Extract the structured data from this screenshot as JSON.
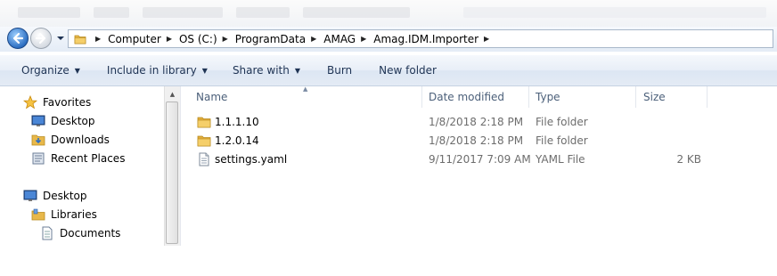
{
  "address": {
    "crumbs": [
      "Computer",
      "OS (C:)",
      "ProgramData",
      "AMAG",
      "Amag.IDM.Importer"
    ]
  },
  "toolbar": {
    "organize": "Organize",
    "include_in_library": "Include in library",
    "share_with": "Share with",
    "burn": "Burn",
    "new_folder": "New folder"
  },
  "sidebar": {
    "favorites": "Favorites",
    "desktop_fav": "Desktop",
    "downloads": "Downloads",
    "recent_places": "Recent Places",
    "desktop": "Desktop",
    "libraries": "Libraries",
    "documents": "Documents"
  },
  "columns": {
    "name": "Name",
    "date_modified": "Date modified",
    "type": "Type",
    "size": "Size"
  },
  "files": [
    {
      "name": "1.1.1.10",
      "date": "1/8/2018 2:18 PM",
      "type": "File folder",
      "size": "",
      "icon": "folder-icon"
    },
    {
      "name": "1.2.0.14",
      "date": "1/8/2018 2:18 PM",
      "type": "File folder",
      "size": "",
      "icon": "folder-icon"
    },
    {
      "name": "settings.yaml",
      "date": "9/11/2017 7:09 AM",
      "type": "YAML File",
      "size": "2 KB",
      "icon": "file-icon"
    }
  ],
  "colors": {
    "toolbar_text": "#1e3354",
    "header_text": "#4c607a",
    "folder": "#e8b84a"
  }
}
